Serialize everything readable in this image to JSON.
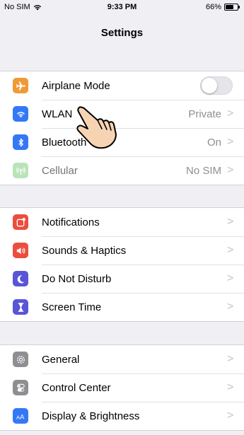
{
  "status": {
    "carrier": "No SIM",
    "time": "9:33 PM",
    "battery": "66%",
    "battery_level": 0.66
  },
  "nav": {
    "title": "Settings"
  },
  "groups": [
    {
      "rows": [
        {
          "label": "Airplane Mode",
          "value": "",
          "icon": "airplane-icon",
          "color": "#f09a37",
          "toggle": false
        },
        {
          "label": "WLAN",
          "value": "Private",
          "icon": "wifi-icon",
          "color": "#3478f6"
        },
        {
          "label": "Bluetooth",
          "value": "On",
          "icon": "bluetooth-icon",
          "color": "#3478f6"
        },
        {
          "label": "Cellular",
          "value": "No SIM",
          "icon": "cellular-icon",
          "color": "#65c466",
          "disabled": true
        }
      ]
    },
    {
      "rows": [
        {
          "label": "Notifications",
          "icon": "notifications-icon",
          "color": "#eb4e3d"
        },
        {
          "label": "Sounds & Haptics",
          "icon": "speaker-icon",
          "color": "#eb4e3d"
        },
        {
          "label": "Do Not Disturb",
          "icon": "moon-icon",
          "color": "#5856d6"
        },
        {
          "label": "Screen Time",
          "icon": "hourglass-icon",
          "color": "#5856d6"
        }
      ]
    },
    {
      "rows": [
        {
          "label": "General",
          "icon": "gear-icon",
          "color": "#8e8e93"
        },
        {
          "label": "Control Center",
          "icon": "toggles-icon",
          "color": "#8e8e93"
        },
        {
          "label": "Display & Brightness",
          "icon": "text-size-icon",
          "color": "#3478f6"
        }
      ]
    }
  ],
  "chevron": ">"
}
